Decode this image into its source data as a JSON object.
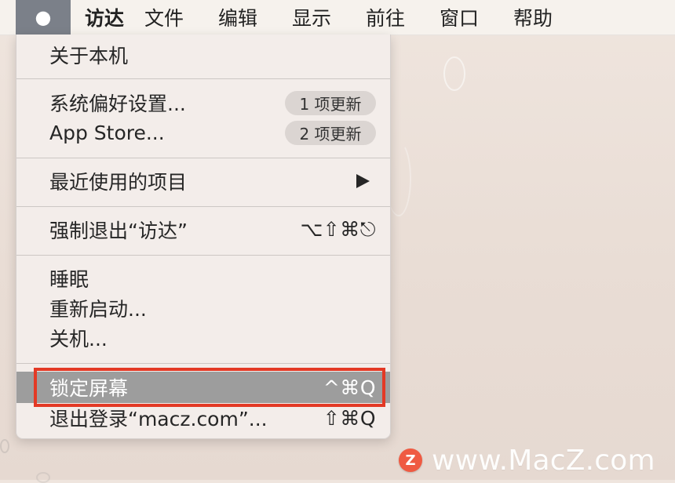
{
  "menubar": {
    "apple_icon_name": "apple-icon",
    "app_name": "访达",
    "items": [
      "文件",
      "编辑",
      "显示",
      "前往",
      "窗口",
      "帮助"
    ]
  },
  "apple_menu": {
    "items": [
      {
        "label": "关于本机"
      },
      {
        "label": "系统偏好设置...",
        "badge": "1 项更新"
      },
      {
        "label": "App Store...",
        "badge": "2 项更新"
      },
      {
        "label": "最近使用的项目",
        "submenu_icon": "chevron-right-icon"
      },
      {
        "label": "强制退出“访达”",
        "shortcut": "⌥⇧⌘⎋"
      },
      {
        "label": "睡眠"
      },
      {
        "label": "重新启动..."
      },
      {
        "label": "关机..."
      },
      {
        "label": "锁定屏幕",
        "shortcut": "^⌘Q",
        "state": "highlighted"
      },
      {
        "label": "退出登录“macz.com”...",
        "shortcut": "⇧⌘Q"
      }
    ]
  },
  "watermark": {
    "text": "www.MacZ.com",
    "logo_letter": "Z"
  },
  "colors": {
    "highlight_gray": "#9d9d9d",
    "annotation_red": "#e33925",
    "menu_background": "#f3edea",
    "apple_tab_background": "#7b8089"
  }
}
